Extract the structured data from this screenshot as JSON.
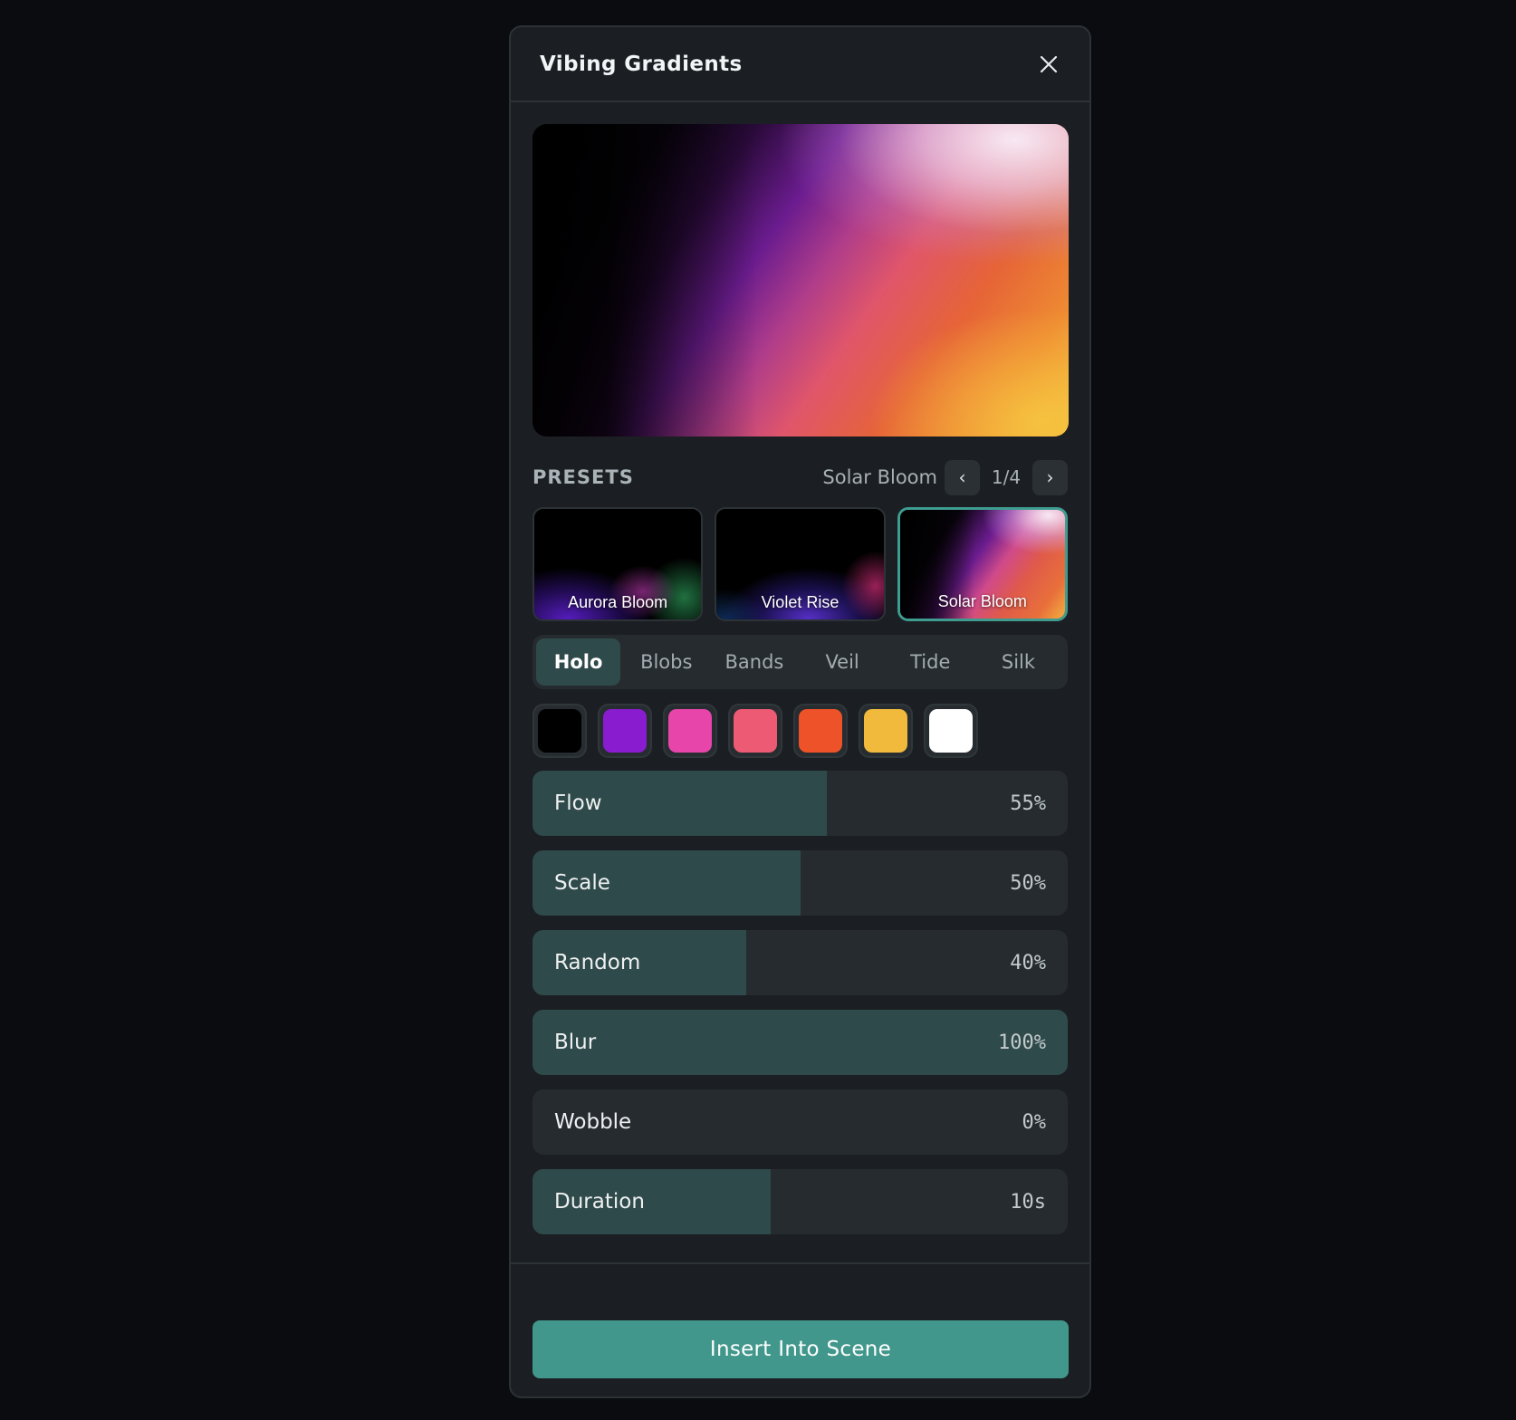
{
  "dialog": {
    "title": "Vibing Gradients"
  },
  "presets": {
    "label": "PRESETS",
    "current_name": "Solar Bloom",
    "counter": "1/4",
    "prev_icon": "chevron-left-icon",
    "next_icon": "chevron-right-icon",
    "items": [
      {
        "label": "Aurora Bloom"
      },
      {
        "label": "Violet Rise"
      },
      {
        "label": "Solar Bloom",
        "selected": true
      }
    ]
  },
  "styles": {
    "tabs": [
      {
        "label": "Holo",
        "active": true
      },
      {
        "label": "Blobs"
      },
      {
        "label": "Bands"
      },
      {
        "label": "Veil"
      },
      {
        "label": "Tide"
      },
      {
        "label": "Silk"
      }
    ]
  },
  "palette": [
    "#000000",
    "#8a1ccf",
    "#e845aa",
    "#ec5a74",
    "#ee5228",
    "#f2ba3c",
    "#ffffff"
  ],
  "sliders": [
    {
      "label": "Flow",
      "value": "55%",
      "fraction": 0.55
    },
    {
      "label": "Scale",
      "value": "50%",
      "fraction": 0.5
    },
    {
      "label": "Random",
      "value": "40%",
      "fraction": 0.4
    },
    {
      "label": "Blur",
      "value": "100%",
      "fraction": 1.0
    },
    {
      "label": "Wobble",
      "value": "0%",
      "fraction": 0.0
    },
    {
      "label": "Duration",
      "value": "10s",
      "fraction": 0.445
    }
  ],
  "actions": {
    "insert_label": "Insert Into Scene"
  },
  "colors": {
    "accent": "#41978b",
    "selected_border": "#3e9c90",
    "panel": "#1b1f23",
    "background": "#0a0c0f"
  }
}
